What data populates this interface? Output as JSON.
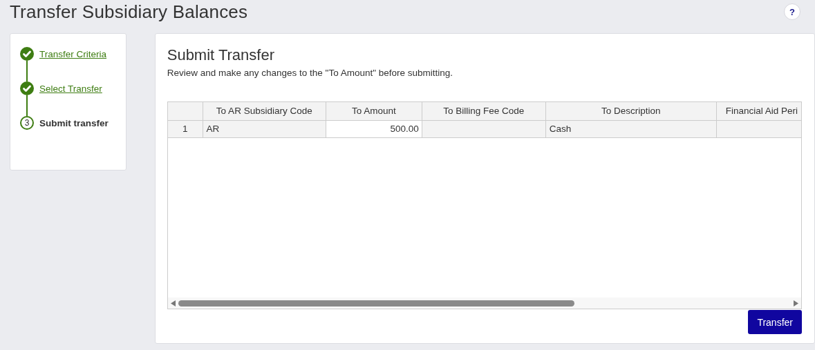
{
  "page_title": "Transfer Subsidiary Balances",
  "help_button": "?",
  "steps": [
    {
      "label": "Transfer Criteria",
      "completed": true
    },
    {
      "label": "Select Transfer",
      "completed": true
    },
    {
      "label": "Submit transfer",
      "completed": false,
      "number": "3"
    }
  ],
  "panel": {
    "title": "Submit Transfer",
    "instructions": "Review and make any changes to the \"To Amount\" before submitting."
  },
  "table": {
    "columns": [
      {
        "label": "To AR Subsidiary Code",
        "kind": "text"
      },
      {
        "label": "To Amount",
        "kind": "input"
      },
      {
        "label": "To Billing Fee Code",
        "kind": "text"
      },
      {
        "label": "To Description",
        "kind": "text"
      },
      {
        "label": "Financial Aid Peri",
        "kind": "text"
      }
    ],
    "rows": [
      {
        "number": "1",
        "cells": [
          "AR",
          "500.00",
          null,
          "Cash",
          null
        ]
      }
    ]
  },
  "buttons": [
    {
      "label": "Transfer"
    }
  ]
}
